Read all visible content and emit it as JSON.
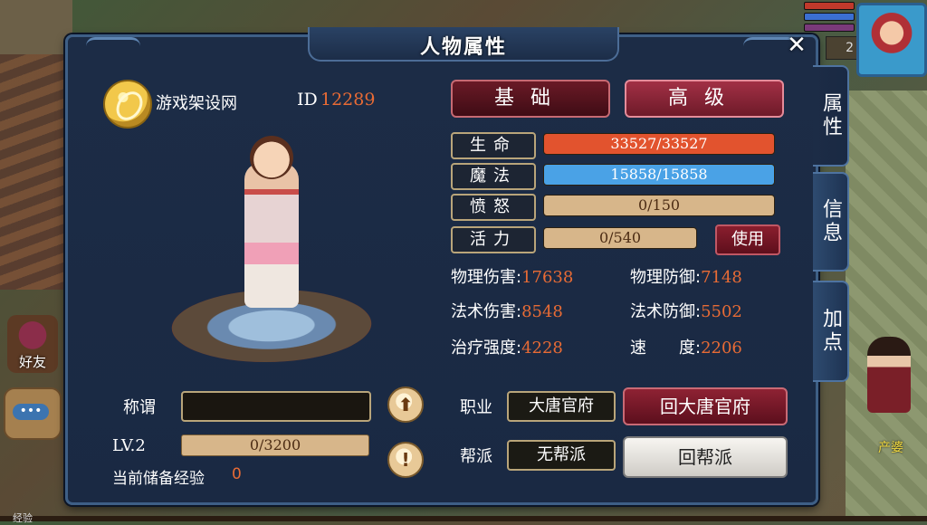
{
  "panel": {
    "title": "人物属性",
    "close_glyph": "✕",
    "side_tabs": [
      "属性",
      "信息",
      "加点"
    ]
  },
  "player": {
    "name": "游戏架设网",
    "id_label": "ID",
    "id_value": "12289",
    "title_label": "称谓",
    "title_value": "",
    "level_label": "LV.2",
    "exp_text": "0/3200",
    "reserve_label": "当前储备经验",
    "reserve_value": "0"
  },
  "tabs": {
    "basic": "基础",
    "advanced": "高级"
  },
  "stats": [
    {
      "label": "生命",
      "value": "33527/33527",
      "fill": 1.0,
      "color": "#e2532e"
    },
    {
      "label": "魔法",
      "value": "15858/15858",
      "fill": 1.0,
      "color": "#4aa2e6"
    },
    {
      "label": "愤怒",
      "value": "0/150",
      "fill": 0.0,
      "color": "#d7b68a"
    },
    {
      "label": "活力",
      "value": "0/540",
      "fill": 0.0,
      "color": "#d7b68a"
    }
  ],
  "use_button": "使用",
  "attributes": [
    {
      "label": "物理伤害:",
      "value": "17638"
    },
    {
      "label": "物理防御:",
      "value": "7148"
    },
    {
      "label": "法术伤害:",
      "value": "8548"
    },
    {
      "label": "法术防御:",
      "value": "5502"
    },
    {
      "label": "治疗强度:",
      "value": "4228"
    },
    {
      "label": "速　　度:",
      "value": "2206"
    }
  ],
  "job": {
    "label": "职业",
    "value": "大唐官府",
    "button": "回大唐官府"
  },
  "guild": {
    "label": "帮派",
    "value": "无帮派",
    "button": "回帮派"
  },
  "hud": {
    "level_badge": "2",
    "friend_label": "好友",
    "chat_label": "•••",
    "npc_name": "产婆",
    "exp_label": "经验"
  },
  "colors": {
    "accent_value": "#e86b35",
    "panel_bg": "#1a2943",
    "gold_border": "#b9a57a"
  }
}
